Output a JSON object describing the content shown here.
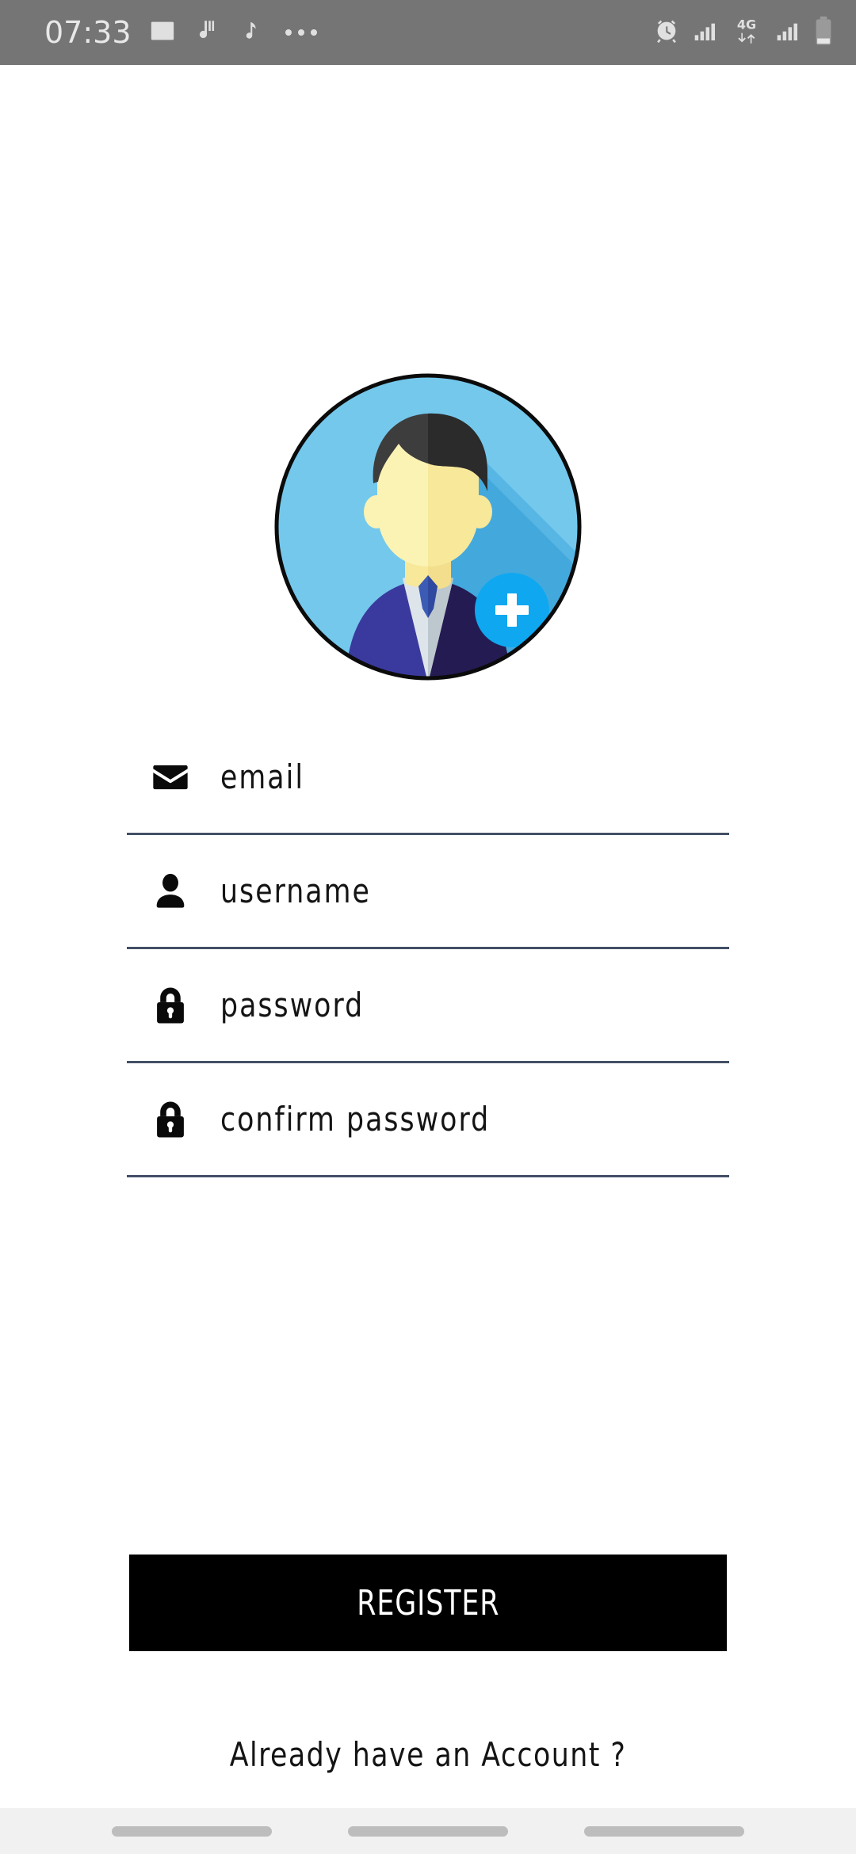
{
  "status_bar": {
    "time": "07:33",
    "left_icons": [
      "gallery-icon",
      "app-icon",
      "music-note-icon",
      "overflow-dots-icon"
    ],
    "right_icons": [
      "alarm-icon",
      "signal-bars-icon",
      "4g-data-icon",
      "signal-bars-2-icon",
      "battery-icon"
    ],
    "network_label": "4G",
    "background_color": "#757575",
    "icon_color": "#e0e0e0"
  },
  "avatar": {
    "name": "profile-avatar",
    "add_badge": "+",
    "colors": {
      "circle_bg": "#74C8EC",
      "circle_shadow": "#3FA7DC",
      "outline": "#0B0B0B",
      "hair_light": "#3D3D3D",
      "hair_dark": "#2B2B2B",
      "face_light": "#FAF3B4",
      "face_dark": "#F7E89A",
      "neck": "#F2DE8C",
      "shirt_light": "#DDE5EA",
      "shirt_dark": "#BCC7CE",
      "tie": "#3B5BB5",
      "tie_dark": "#2F49A0",
      "suit_light": "#3A3A9E",
      "suit_dark": "#241B52",
      "badge_bg": "#0FA8F0",
      "badge_plus": "#FFFFFF"
    }
  },
  "form": {
    "underline_color": "#434F66",
    "fields": [
      {
        "name": "email-field",
        "icon": "envelope-icon",
        "placeholder": "email"
      },
      {
        "name": "username-field",
        "icon": "person-icon",
        "placeholder": "username"
      },
      {
        "name": "password-field",
        "icon": "lock-icon",
        "placeholder": "password"
      },
      {
        "name": "confirm-password-field",
        "icon": "lock-icon",
        "placeholder": "confirm password"
      }
    ]
  },
  "register_button": {
    "label": "REGISTER",
    "background_color": "#000000",
    "text_color": "#FFFFFF"
  },
  "footer": {
    "account_link": "Already have an Account ?"
  },
  "nav_bar": {
    "items": [
      "recents-pill",
      "home-pill",
      "back-pill"
    ],
    "background_color": "#f1f1f1",
    "pill_color": "#bdbdbd"
  }
}
